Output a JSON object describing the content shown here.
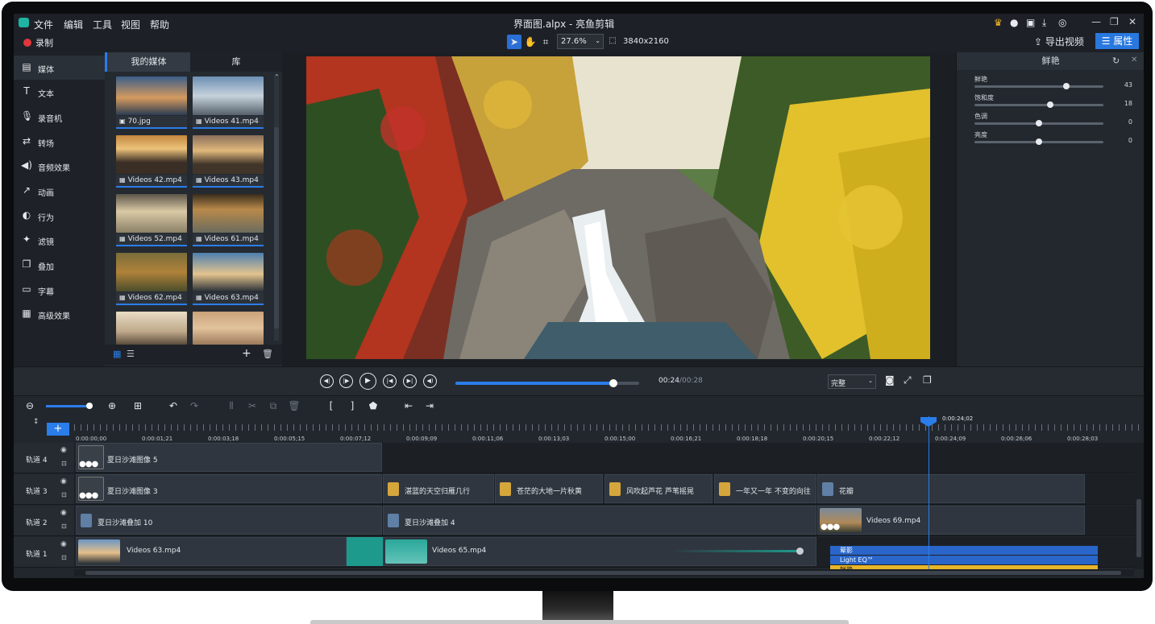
{
  "menu": {
    "file": "文件",
    "edit": "编辑",
    "tools": "工具",
    "view": "视图",
    "help": "帮助"
  },
  "window_title": "界面图.alpx - 亮鱼剪辑",
  "record_label": "录制",
  "toolbar": {
    "zoom": "27.6%",
    "resolution": "3840x2160",
    "export_label": "导出视频",
    "properties_label": "属性"
  },
  "sidebar": {
    "items": [
      {
        "label": "媒体",
        "icon": "media-icon"
      },
      {
        "label": "文本",
        "icon": "text-icon"
      },
      {
        "label": "录音机",
        "icon": "microphone-icon"
      },
      {
        "label": "转场",
        "icon": "transition-icon"
      },
      {
        "label": "音频效果",
        "icon": "audio-effect-icon"
      },
      {
        "label": "动画",
        "icon": "animation-icon"
      },
      {
        "label": "行为",
        "icon": "behavior-icon"
      },
      {
        "label": "滤镜",
        "icon": "filter-icon"
      },
      {
        "label": "叠加",
        "icon": "overlay-icon"
      },
      {
        "label": "字幕",
        "icon": "subtitle-icon"
      },
      {
        "label": "高级效果",
        "icon": "advanced-effect-icon"
      }
    ]
  },
  "media": {
    "tabs": [
      "我的媒体",
      "库"
    ],
    "items": [
      {
        "name": "70.jpg",
        "type": "image"
      },
      {
        "name": "Videos 41.mp4",
        "type": "video"
      },
      {
        "name": "Videos 42.mp4",
        "type": "video"
      },
      {
        "name": "Videos 43.mp4",
        "type": "video"
      },
      {
        "name": "Videos 52.mp4",
        "type": "video"
      },
      {
        "name": "Videos 61.mp4",
        "type": "video"
      },
      {
        "name": "Videos 62.mp4",
        "type": "video"
      },
      {
        "name": "Videos 63.mp4",
        "type": "video"
      }
    ]
  },
  "properties": {
    "title": "鲜艳",
    "rows": [
      {
        "label": "鲜艳",
        "value": "43",
        "level": 0.71
      },
      {
        "label": "饱和度",
        "value": "18",
        "level": 0.59
      },
      {
        "label": "色调",
        "value": "0",
        "level": 0.5
      },
      {
        "label": "亮度",
        "value": "0",
        "level": 0.5
      }
    ]
  },
  "transport": {
    "current_time": "00:24",
    "total_time": "/00:28",
    "progress": 0.86,
    "quality": "完整"
  },
  "timeline": {
    "playhead_time": "0:00:24;02",
    "ruler": [
      "0:00:00;00",
      "0:00:01;21",
      "0:00:03;18",
      "0:00:05;15",
      "0:00:07;12",
      "0:00:09;09",
      "0:00:11;06",
      "0:00:13;03",
      "0:00:15;00",
      "0:00:16;21",
      "0:00:18;18",
      "0:00:20;15",
      "0:00:22;12",
      "0:00:24;09",
      "0:00:26;06",
      "0:00:28;03"
    ],
    "tracks": [
      "轨道 4",
      "轨道 3",
      "轨道 2",
      "轨道 1"
    ],
    "clips": {
      "t4_1": "夏日沙滩图像 5",
      "t3_1": "夏日沙滩图像 3",
      "t3_2": "湛蓝的天空归雁几行",
      "t3_3": "苍茫的大地一片秋黄",
      "t3_4": "风吹起芦花 芦苇摇晃",
      "t3_5": "一年又一年 不变的向往",
      "t3_6": "花瓣",
      "t2_1": "夏日沙滩叠加 10",
      "t2_2": "夏日沙滩叠加 4",
      "t2_3": "Videos 69.mp4",
      "t1_1": "Videos 63.mp4",
      "t1_2": "Videos 65.mp4",
      "fx1": "晕影",
      "fx2": "Light EQ™",
      "fx3": "鲜艳"
    }
  },
  "colors": {
    "accent": "#2b7de9",
    "title_clip": "#d4a63b",
    "overlay_clip": "#5f7fa5",
    "transition": "#1e9a8c",
    "fx_blue": "#2a66c9",
    "fx_yellow": "#e8b52a"
  }
}
